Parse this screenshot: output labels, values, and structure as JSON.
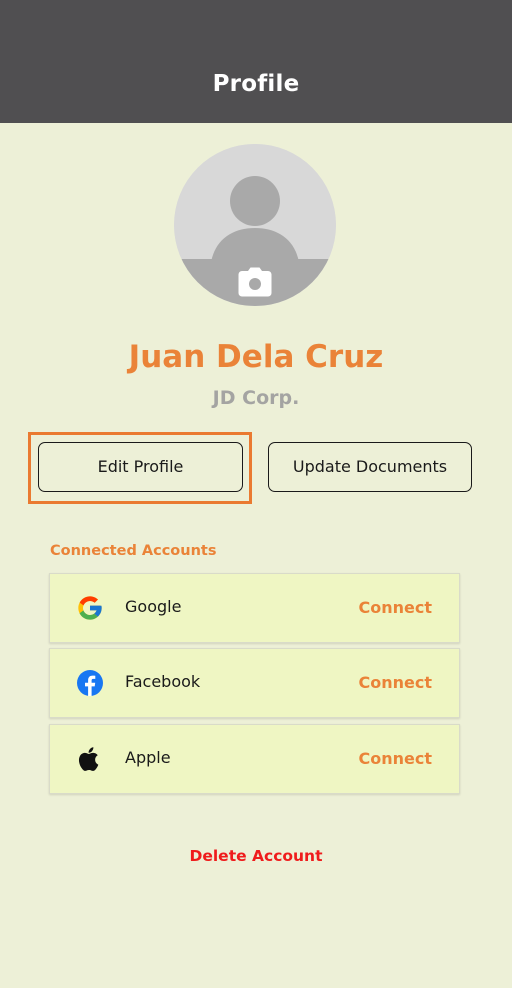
{
  "header": {
    "title": "Profile"
  },
  "profile": {
    "name": "Juan Dela Cruz",
    "company": "JD Corp."
  },
  "buttons": {
    "edit_profile": "Edit Profile",
    "update_documents": "Update Documents"
  },
  "connected_accounts": {
    "title": "Connected Accounts",
    "items": [
      {
        "label": "Google",
        "action": "Connect",
        "icon": "google-icon"
      },
      {
        "label": "Facebook",
        "action": "Connect",
        "icon": "facebook-icon"
      },
      {
        "label": "Apple",
        "action": "Connect",
        "icon": "apple-icon"
      }
    ]
  },
  "delete_account": "Delete Account",
  "colors": {
    "accent": "#ea8338",
    "header_bg": "#504f51",
    "page_bg": "#edf0d7",
    "row_bg": "#eff6c3",
    "danger": "#ef1c1c"
  }
}
